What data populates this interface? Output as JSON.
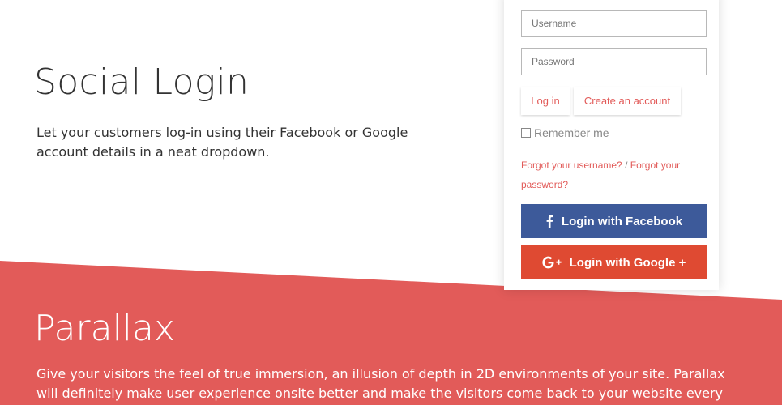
{
  "social_login": {
    "title": "Social Login",
    "description": "Let your customers log-in using their Facebook or Google account details in a neat dropdown."
  },
  "login_form": {
    "username_placeholder": "Username",
    "password_placeholder": "Password",
    "login_label": "Log in",
    "create_account_label": "Create an account",
    "remember_label": "Remember me",
    "forgot_username": "Forgot your username?",
    "separator": "/",
    "forgot_password": "Forgot your password?",
    "facebook_label": "Login with Facebook",
    "google_label": "Login with Google +"
  },
  "parallax": {
    "title": "Parallax",
    "description": "Give your visitors the feel of true immersion, an illusion of depth in 2D environments of your site. Parallax will definitely make user experience onsite better and make the visitors come back to your website every now and"
  },
  "colors": {
    "accent": "#e25b59",
    "facebook": "#3d5a9a",
    "google": "#df4a32"
  },
  "icons": {
    "facebook": "facebook-icon",
    "google": "google-plus-icon"
  }
}
